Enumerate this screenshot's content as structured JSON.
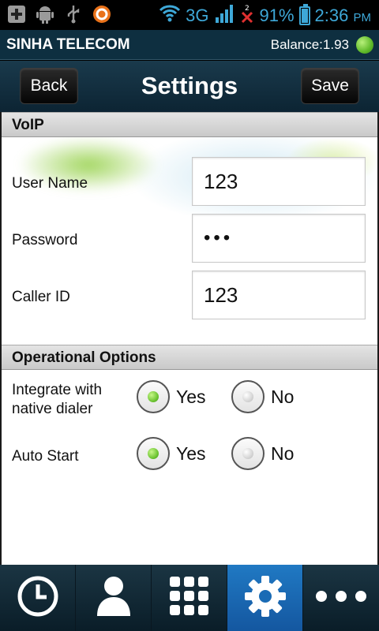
{
  "status_bar": {
    "network": "3G",
    "battery": "91%",
    "battery_level": 0.91,
    "time": "2:36",
    "time_suffix": "PM",
    "icons": [
      "add-box-icon",
      "android-icon",
      "usb-icon",
      "app-circle-icon",
      "wifi-icon",
      "signal-icon",
      "missed-call-icon",
      "battery-charging-icon"
    ]
  },
  "carrier": {
    "name": "SINHA TELECOM",
    "balance": "Balance:1.93",
    "status_color": "#5fba2a"
  },
  "titlebar": {
    "title": "Settings",
    "back_label": "Back",
    "save_label": "Save"
  },
  "voip": {
    "header": "VoIP",
    "fields": [
      {
        "label": "User Name",
        "value": "123"
      },
      {
        "label": "Password",
        "value": "•••"
      },
      {
        "label": "Caller ID",
        "value": "123"
      }
    ]
  },
  "options": {
    "header": "Operational Options",
    "rows": [
      {
        "label_line1": "Integrate with",
        "label_line2": "native dialer",
        "yes": "Yes",
        "no": "No",
        "selected": "yes"
      },
      {
        "label_line1": "Auto Start",
        "label_line2": "",
        "yes": "Yes",
        "no": "No",
        "selected": "yes"
      }
    ]
  },
  "bottom_nav": {
    "items": [
      "history-icon",
      "contacts-icon",
      "dialpad-icon",
      "settings-icon",
      "more-icon"
    ],
    "active": "settings-icon",
    "accent": "#1a6bb5"
  }
}
